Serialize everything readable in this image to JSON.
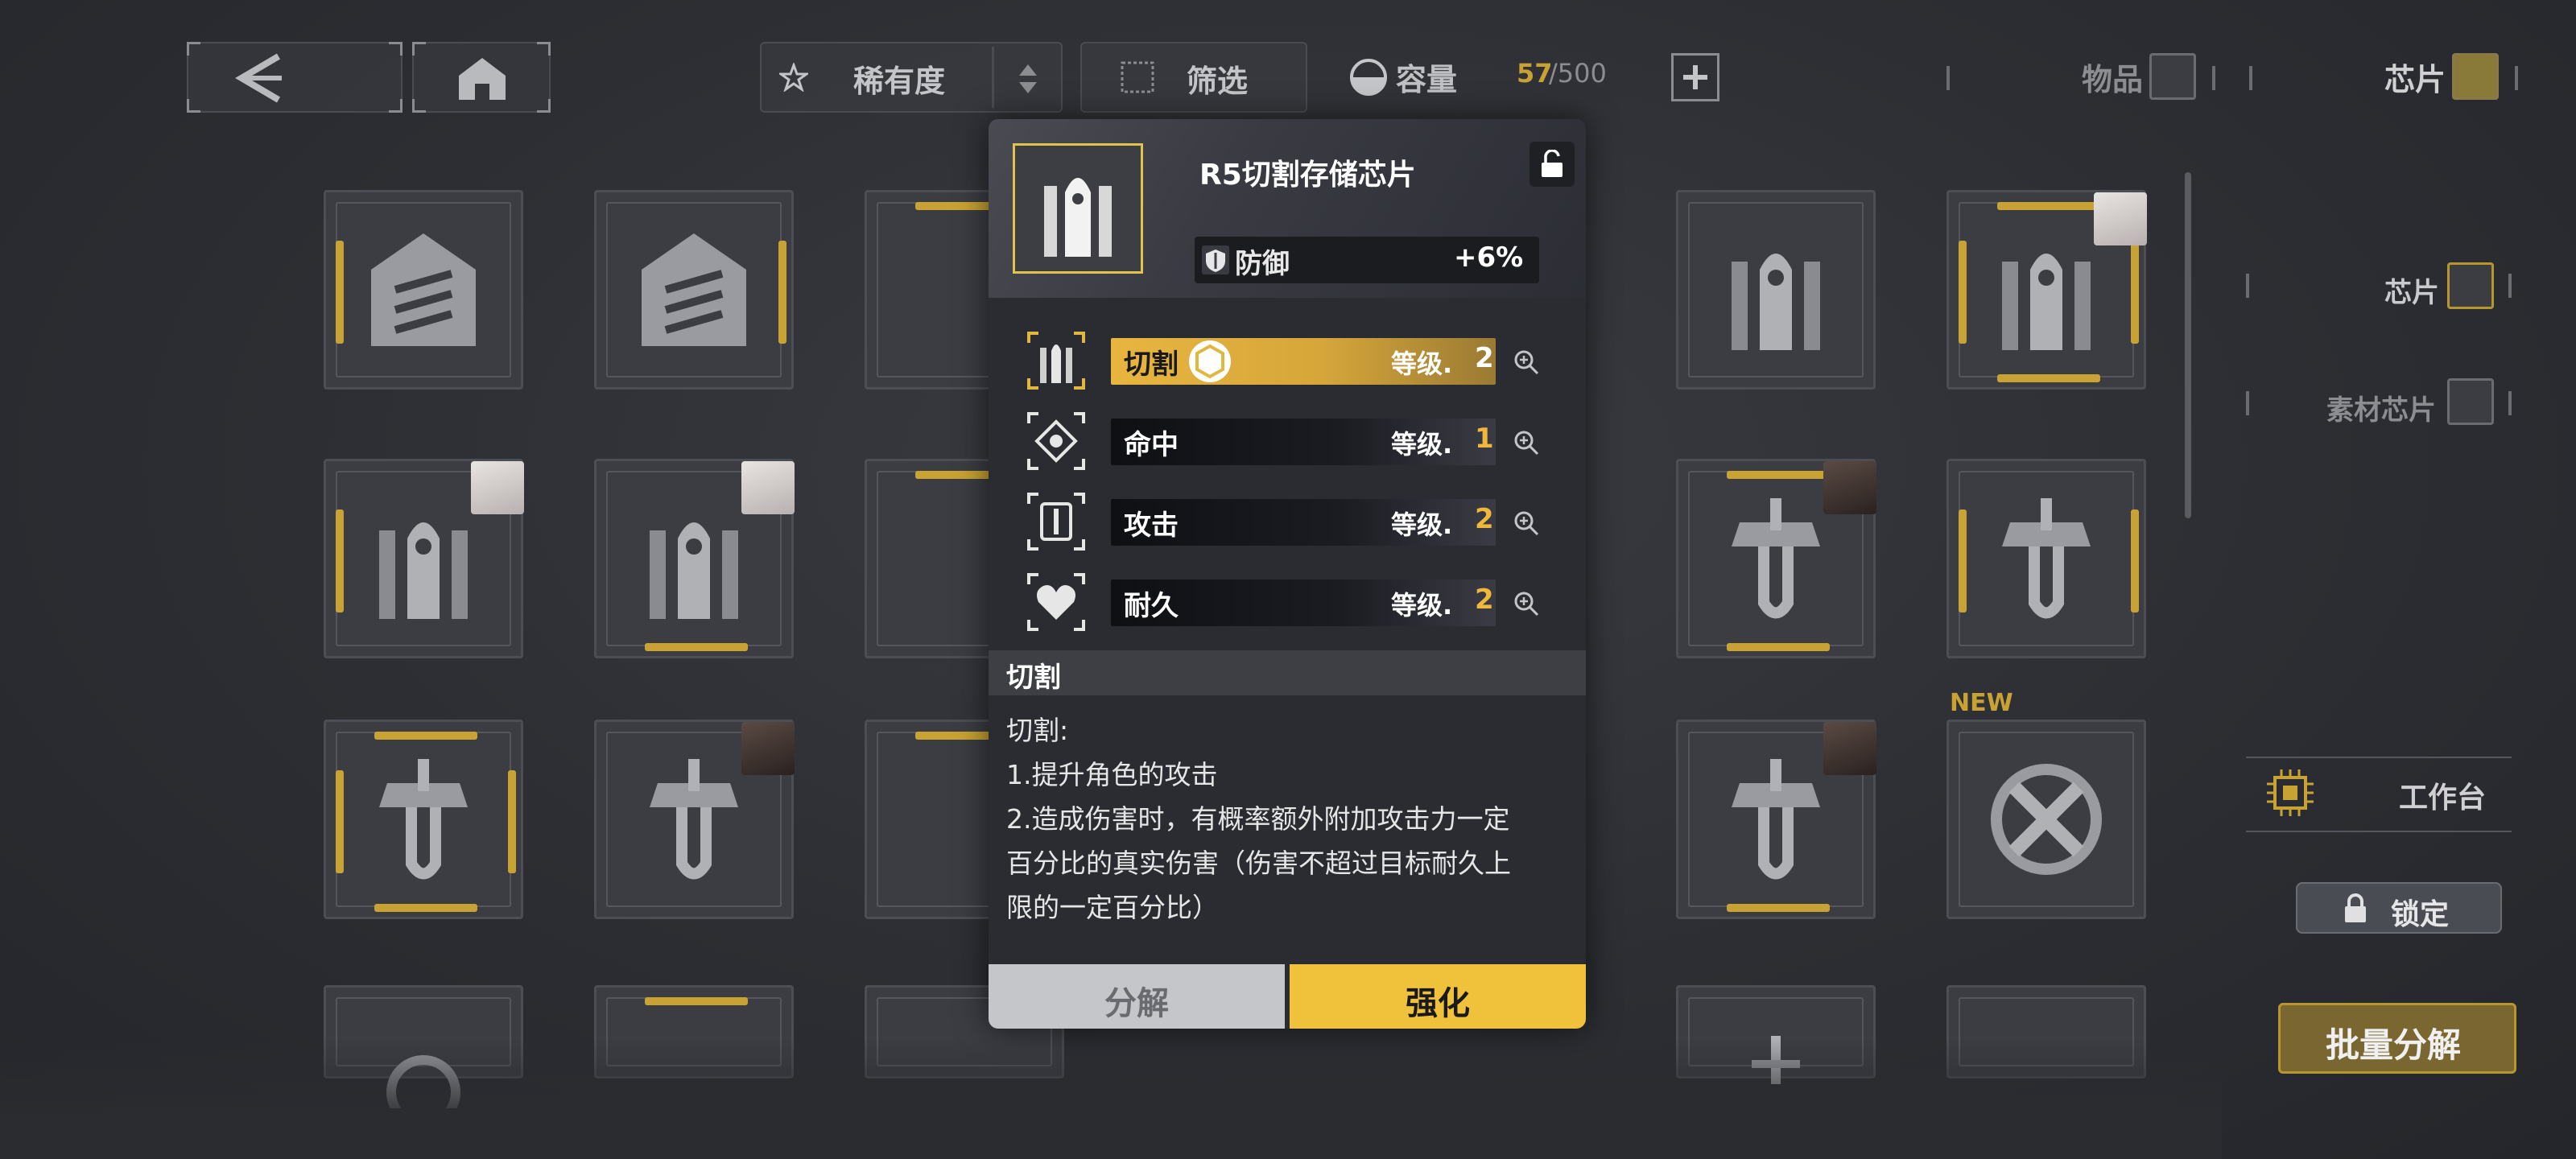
{
  "topbar": {
    "sort_label": "稀有度",
    "filter_label": "筛选",
    "capacity_label": "容量",
    "capacity_current": "57",
    "capacity_max": "/500",
    "tab_items": "物品",
    "tab_chips": "芯片"
  },
  "sidebar": {
    "chips": "芯片",
    "material_chips": "素材芯片",
    "workbench": "工作台",
    "lock": "锁定",
    "batch_decompose": "批量分解"
  },
  "grid": {
    "new_tag": "NEW"
  },
  "popup": {
    "title": "R5切割存储芯片",
    "stat_label": "防御",
    "stat_value": "+6%",
    "level_prefix": "等级.",
    "skills": [
      {
        "name": "切割",
        "level": "2",
        "highlighted": true
      },
      {
        "name": "命中",
        "level": "1",
        "highlighted": false
      },
      {
        "name": "攻击",
        "level": "2",
        "highlighted": false
      },
      {
        "name": "耐久",
        "level": "2",
        "highlighted": false
      }
    ],
    "desc_title": "切割",
    "desc_lines": [
      "切割:",
      "1.提升角色的攻击",
      "2.造成伤害时，有概率额外附加攻击力一定",
      "百分比的真实伤害（伤害不超过目标耐久上",
      "限的一定百分比）"
    ],
    "btn_decompose": "分解",
    "btn_enhance": "强化"
  },
  "colors": {
    "gold": "#f0c23c",
    "accent_bar": "#c9a234",
    "background": "#2e3035"
  }
}
